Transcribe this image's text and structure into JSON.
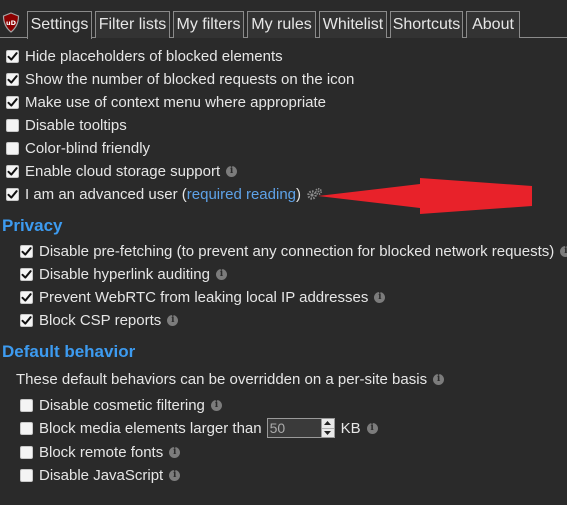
{
  "tabs": [
    {
      "label": "Settings",
      "active": true
    },
    {
      "label": "Filter lists",
      "active": false
    },
    {
      "label": "My filters",
      "active": false
    },
    {
      "label": "My rules",
      "active": false
    },
    {
      "label": "Whitelist",
      "active": false
    },
    {
      "label": "Shortcuts",
      "active": false
    },
    {
      "label": "About",
      "active": false
    }
  ],
  "general": {
    "hide_placeholders": {
      "label": "Hide placeholders of blocked elements",
      "checked": true
    },
    "show_count": {
      "label": "Show the number of blocked requests on the icon",
      "checked": true
    },
    "context_menu": {
      "label": "Make use of context menu where appropriate",
      "checked": true
    },
    "disable_tooltips": {
      "label": "Disable tooltips",
      "checked": false
    },
    "color_blind": {
      "label": "Color-blind friendly",
      "checked": false
    },
    "cloud_storage": {
      "label": "Enable cloud storage support",
      "checked": true
    },
    "advanced_user": {
      "label_prefix": "I am an advanced user (",
      "link_text": "required reading",
      "label_suffix": ")",
      "checked": true
    }
  },
  "privacy": {
    "heading": "Privacy",
    "prefetching": {
      "label": "Disable pre-fetching (to prevent any connection for blocked network requests)",
      "checked": true
    },
    "hyperlink_auditing": {
      "label": "Disable hyperlink auditing",
      "checked": true
    },
    "webrtc": {
      "label": "Prevent WebRTC from leaking local IP addresses",
      "checked": true
    },
    "csp_reports": {
      "label": "Block CSP reports",
      "checked": true
    }
  },
  "default_behavior": {
    "heading": "Default behavior",
    "description": "These default behaviors can be overridden on a per-site basis",
    "cosmetic": {
      "label": "Disable cosmetic filtering",
      "checked": false
    },
    "media": {
      "label_prefix": "Block media elements larger than",
      "value": "50",
      "unit": "KB",
      "checked": false
    },
    "remote_fonts": {
      "label": "Block remote fonts",
      "checked": false
    },
    "javascript": {
      "label": "Disable JavaScript",
      "checked": false
    }
  },
  "icons": {
    "logo": "ublock-logo-icon",
    "info": "info-icon",
    "gears": "gears-icon",
    "arrow": "red-arrow-annotation",
    "checkmark": "checkmark-icon"
  },
  "colors": {
    "background": "#2a2a2a",
    "text": "#e6e6e6",
    "heading": "#3d9bf0",
    "link": "#5ea2e8",
    "arrow": "#e8222a",
    "logo": "#8b0000"
  }
}
